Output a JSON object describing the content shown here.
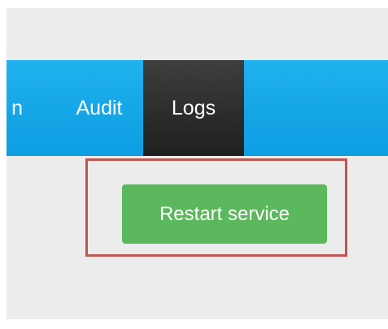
{
  "navbar": {
    "items": [
      {
        "label": "n",
        "truncated": true,
        "active": false
      },
      {
        "label": "Audit",
        "active": false
      },
      {
        "label": "Logs",
        "active": true
      }
    ]
  },
  "actions": {
    "restart_label": "Restart service"
  },
  "colors": {
    "navbar_blue": "#1aa8e8",
    "active_tab_dark": "#2d2d2d",
    "button_green": "#5cb85c",
    "highlight_red": "#c05451",
    "background_gray": "#ececec"
  }
}
